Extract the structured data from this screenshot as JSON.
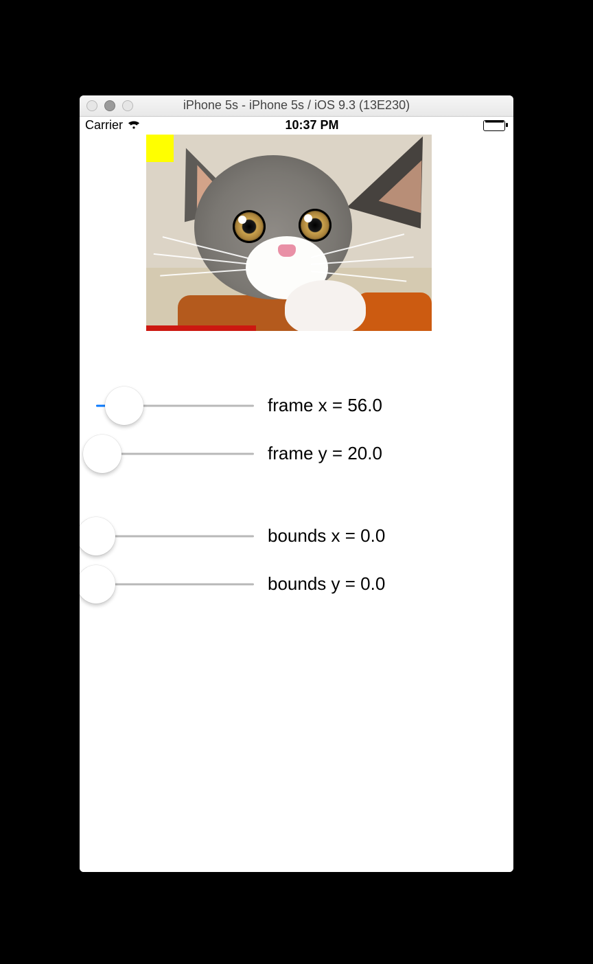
{
  "window": {
    "title": "iPhone 5s - iPhone 5s / iOS 9.3 (13E230)"
  },
  "statusbar": {
    "carrier": "Carrier",
    "time": "10:37 PM"
  },
  "sliders": {
    "frame_x": {
      "label": "frame x = 56.0",
      "value": 56.0,
      "fraction": 0.18
    },
    "frame_y": {
      "label": "frame y = 20.0",
      "value": 20.0,
      "fraction": 0.04
    },
    "bounds_x": {
      "label": "bounds x = 0.0",
      "value": 0.0,
      "fraction": 0.0
    },
    "bounds_y": {
      "label": "bounds y = 0.0",
      "value": 0.0,
      "fraction": 0.0
    }
  }
}
